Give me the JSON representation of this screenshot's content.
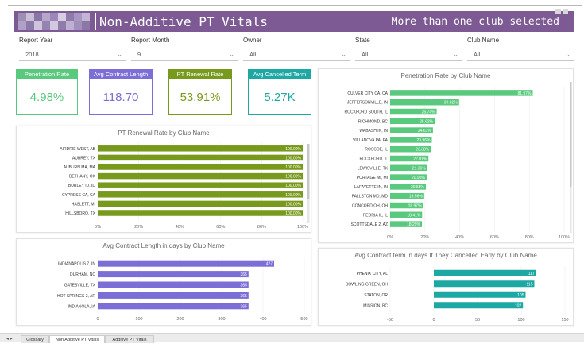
{
  "header": {
    "title": "Non-Additive PT Vitals",
    "selection_note": "More than one club selected"
  },
  "filters": [
    {
      "label": "Report Year",
      "value": "2018"
    },
    {
      "label": "Report Month",
      "value": "9"
    },
    {
      "label": "Owner",
      "value": "All"
    },
    {
      "label": "State",
      "value": "All"
    },
    {
      "label": "Club Name",
      "value": "All"
    }
  ],
  "kpis": [
    {
      "title": "Penetration Rate",
      "value": "4.98%",
      "color": "#59c97d"
    },
    {
      "title": "Avg Contract Length",
      "value": "118.70",
      "color": "#7c6ed7"
    },
    {
      "title": "PT Renewal Rate",
      "value": "53.91%",
      "color": "#789a1c"
    },
    {
      "title": "Avg Cancelled Term",
      "value": "5.27K",
      "color": "#1da8a4"
    }
  ],
  "charts": {
    "renewal": {
      "title": "PT Renewal Rate by Club Name"
    },
    "penetration": {
      "title": "Penetration Rate by Club Name"
    },
    "contract": {
      "title": "Avg Contract Length in days by Club Name"
    },
    "cancelled": {
      "title": "Avg Contract term in days If They Cancelled Early by Club Name"
    }
  },
  "chart_data": [
    {
      "type": "bar",
      "orientation": "horizontal",
      "title": "PT Renewal Rate by Club Name",
      "color": "#789a1c",
      "categories": [
        "AIRDRIE WEST, AB",
        "AUBREY, TX",
        "AUBURN MA, MA",
        "BETHANY, OK",
        "BURLEY ID, ID",
        "CYPRESS CA, CA",
        "HASLETT, MI",
        "HILLSBORO, TX"
      ],
      "values": [
        100,
        100,
        100,
        100,
        100,
        100,
        100,
        100
      ],
      "labels": [
        "100.00%",
        "100.00%",
        "100.00%",
        "100.00%",
        "100.00%",
        "100.00%",
        "100.00%",
        "100.00%"
      ],
      "ticks": [
        "0%",
        "20%",
        "40%",
        "60%",
        "80%",
        "100%"
      ],
      "xlim": [
        0,
        100
      ]
    },
    {
      "type": "bar",
      "orientation": "horizontal",
      "title": "Penetration Rate by Club Name",
      "color": "#59c97d",
      "categories": [
        "CULVER CITY CA, CA",
        "JEFFERSONVILLE, IN",
        "ROCKFORD SOUTH, IL",
        "RICHMOND, BC",
        "WABASH IN, IN",
        "VILLANOVA PA, PA",
        "ROSCOE, IL",
        "ROCKFORD, IL",
        "LEWISVILLE, TX",
        "PORTAGE MI, MI",
        "LAFAYETTE IN, IN",
        "FALLSTON MD, MD",
        "CONCORD OH, OH",
        "PEORIA IL, IL",
        "SCOTTSDALE 2, AZ"
      ],
      "values": [
        81.97,
        39.62,
        26.74,
        25.62,
        24.61,
        23.96,
        23.38,
        22.01,
        21.36,
        20.98,
        20.55,
        19.56,
        18.97,
        18.41,
        18.29
      ],
      "labels": [
        "81.97%",
        "39.62%",
        "26.74%",
        "25.62%",
        "24.61%",
        "23.96%",
        "23.38%",
        "22.01%",
        "21.36%",
        "20.98%",
        "20.55%",
        "19.56%",
        "18.97%",
        "18.41%",
        "18.29%"
      ],
      "ticks": [
        "0%",
        "20%",
        "40%",
        "60%",
        "80%",
        "100%"
      ],
      "xlim": [
        0,
        100
      ]
    },
    {
      "type": "bar",
      "orientation": "horizontal",
      "title": "Avg Contract Length in days by Club Name",
      "color": "#7c6ed7",
      "categories": [
        "INDIANAPOLIS 7, IN",
        "DURHAM, NC",
        "GATESVILLE, TX",
        "HOT SPRINGS 2, AR",
        "INDIANOLA, IA"
      ],
      "values": [
        427,
        365,
        365,
        365,
        365
      ],
      "labels": [
        "427",
        "365",
        "365",
        "365",
        "365"
      ],
      "ticks": [
        "0",
        "100",
        "200",
        "300",
        "400",
        "500"
      ],
      "xlim": [
        0,
        500
      ]
    },
    {
      "type": "bar",
      "orientation": "horizontal",
      "title": "Avg Contract term in days If They Cancelled Early by Club Name",
      "color": "#1da8a4",
      "categories": [
        "PHENIX CITY, AL",
        "BOWLING GREEN, OH",
        "STATON, OR",
        "MISSION, BC"
      ],
      "values": [
        117,
        115,
        105,
        102
      ],
      "labels": [
        "117",
        "115",
        "105",
        "102"
      ],
      "ticks": [
        "-50",
        "0",
        "50",
        "100",
        "150"
      ],
      "xlim": [
        -50,
        150
      ]
    }
  ],
  "tabs": [
    "Glossary",
    "Non Additive PT Vitals",
    "Additive PT Vitals"
  ],
  "tab_nav": "◂ ▸"
}
